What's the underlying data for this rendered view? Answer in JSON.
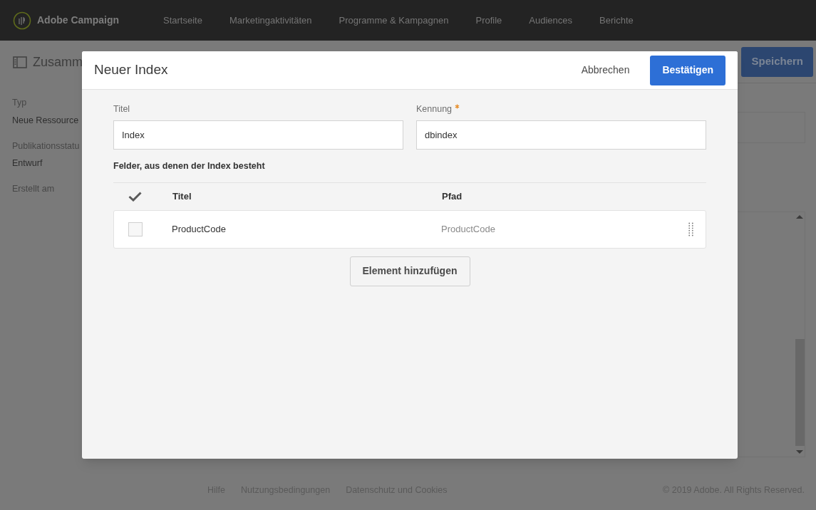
{
  "app": {
    "name": "Adobe Campaign"
  },
  "nav": [
    "Startseite",
    "Marketingaktivitäten",
    "Programme & Kampagnen",
    "Profile",
    "Audiences",
    "Berichte"
  ],
  "page": {
    "title": "Zusamm",
    "save_button": "Speichern",
    "sidebar": [
      {
        "label": "Typ",
        "value": "Neue Ressource"
      },
      {
        "label": "Publikationsstatu",
        "value": "Entwurf"
      },
      {
        "label": "Erstellt am"
      }
    ]
  },
  "footer": {
    "links": [
      "Hilfe",
      "Nutzungsbedingungen",
      "Datenschutz und Cookies"
    ],
    "copyright": "© 2019 Adobe. All Rights Reserved."
  },
  "dialog": {
    "title": "Neuer Index",
    "cancel": "Abbrechen",
    "confirm": "Bestätigen",
    "fields": [
      {
        "label": "Titel",
        "required": false,
        "value": "Index"
      },
      {
        "label": "Kennung",
        "required": true,
        "value": "dbindex"
      }
    ],
    "section": "Felder, aus denen der Index besteht",
    "columns": [
      "Titel",
      "Pfad"
    ],
    "rows": [
      {
        "title": "ProductCode",
        "path": "ProductCode",
        "checked": false
      }
    ],
    "add_button": "Element hinzufügen"
  }
}
